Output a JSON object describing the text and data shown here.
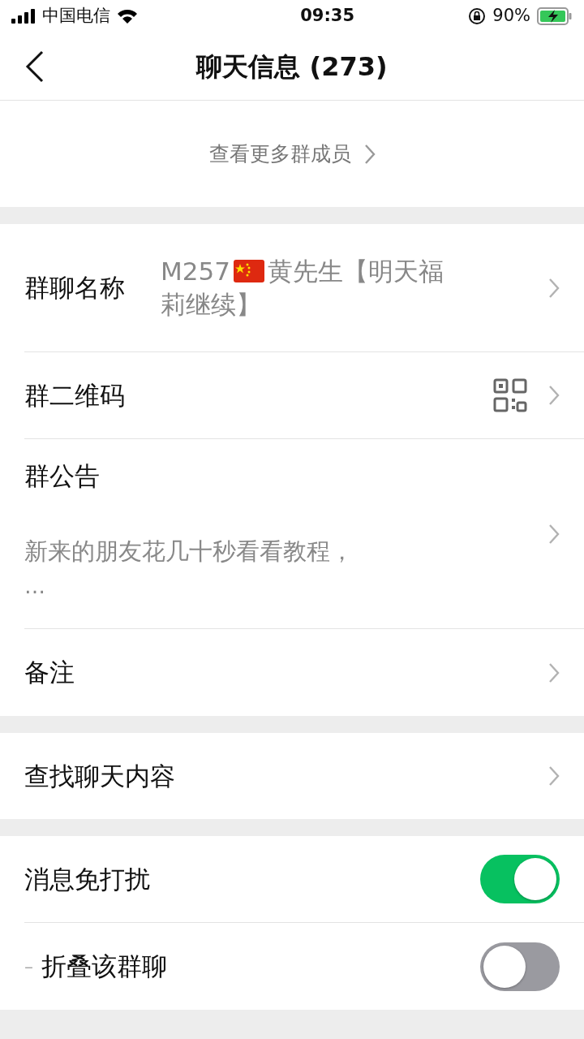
{
  "status_bar": {
    "carrier": "中国电信",
    "time": "09:35",
    "battery": "90%"
  },
  "header": {
    "title": "聊天信息 (273)"
  },
  "more_members": "查看更多群成员",
  "sections": [
    [
      {
        "kind": "name",
        "label": "群聊名称",
        "value_before": "M257",
        "value_after": "黄先生【明天福",
        "value_line2": "莉继续】"
      },
      {
        "kind": "qr",
        "label": "群二维码"
      },
      {
        "kind": "notice",
        "label": "群公告",
        "preview": "新来的朋友花几十秒看看教程，",
        "ellipsis": "…"
      },
      {
        "kind": "link",
        "label": "备注"
      }
    ],
    [
      {
        "kind": "link",
        "label": "查找聊天内容"
      }
    ],
    [
      {
        "kind": "switch",
        "label": "消息免打扰",
        "on": true,
        "disabled": false
      },
      {
        "kind": "switch",
        "label": "折叠该群聊",
        "dash": "–",
        "on": false,
        "disabled": true
      }
    ]
  ]
}
